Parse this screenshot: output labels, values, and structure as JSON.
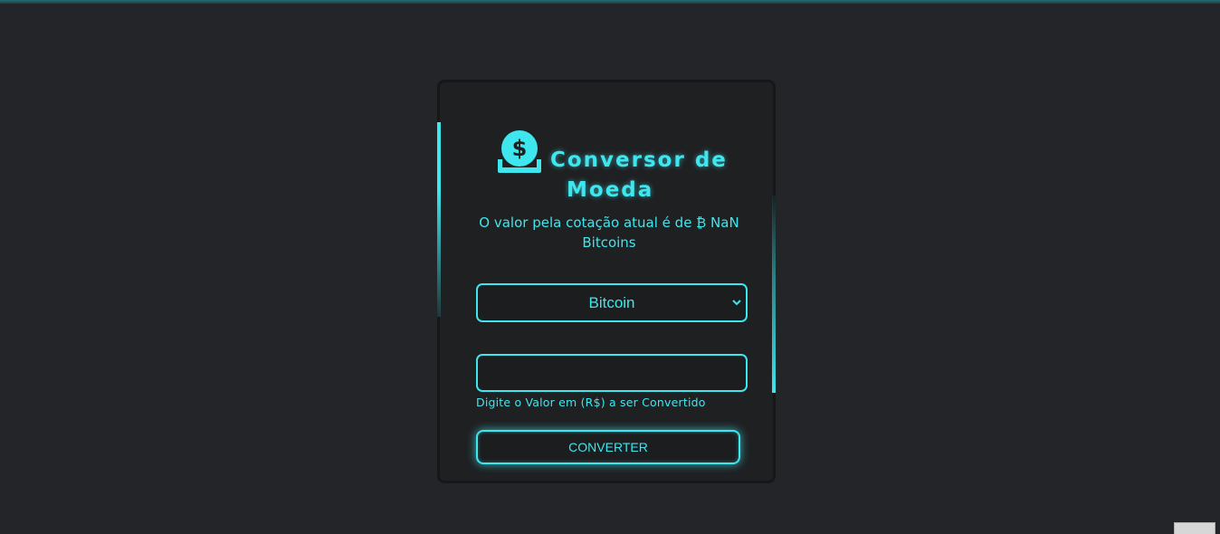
{
  "app": {
    "title_line1": "Conversor de",
    "title_line2": "Moeda",
    "accent_color": "#3ee6ee",
    "icon": "coin-dollar-icon"
  },
  "result": {
    "text": "O valor pela cotação atual é de ₿ NaN Bitcoins"
  },
  "currency_select": {
    "selected": "Bitcoin",
    "icon": "chevron-down-icon"
  },
  "amount_input": {
    "value": "",
    "hint": "Digite o Valor em (R$) a ser Convertido"
  },
  "convert_button": {
    "label": "CONVERTER"
  }
}
